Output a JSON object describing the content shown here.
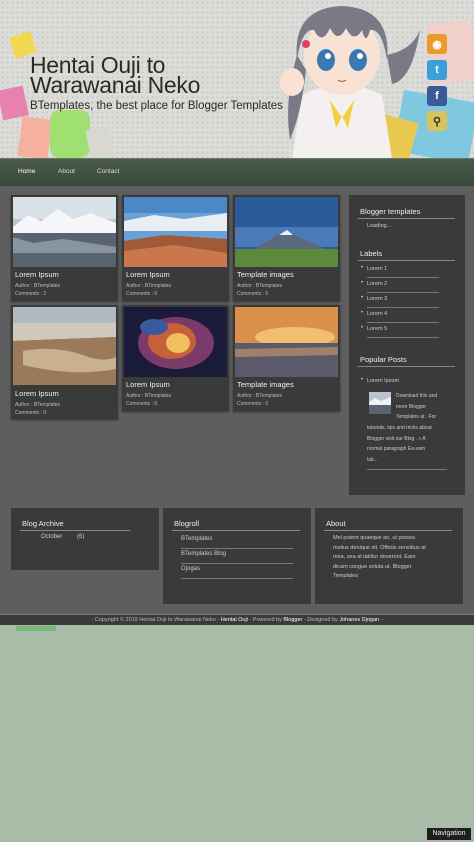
{
  "header": {
    "title": "Hentai Ouji to Warawanai Neko",
    "description": "BTemplates, the best place for Blogger Templates",
    "social": [
      "rss-icon",
      "twitter-icon",
      "facebook-icon",
      "search-icon"
    ],
    "colors": {
      "rss": "#e89a2a",
      "twitter": "#3aa0d8",
      "facebook": "#3b5a9a",
      "search": "#d8c45a"
    }
  },
  "nav": {
    "items": [
      "Home",
      "About",
      "Contact"
    ]
  },
  "posts": [
    {
      "title": "Lorem Ipsum",
      "author": "Author : BTemplates",
      "comments": "Comments : 2"
    },
    {
      "title": "Lorem Ipsum",
      "author": "Author : BTemplates",
      "comments": "Comments : 0"
    },
    {
      "title": "Template images",
      "author": "Author : BTemplates",
      "comments": "Comments : 5"
    },
    {
      "title": "Lorem Ipsum",
      "author": "Author : BTemplates",
      "comments": "Comments : 0"
    },
    {
      "title": "Lorem Ipsum",
      "author": "Author : BTemplates",
      "comments": "Comments : 0"
    },
    {
      "title": "Template images",
      "author": "Author : BTemplates",
      "comments": "Comments : 0"
    }
  ],
  "sidebar": {
    "blogger_heading": "Blogger templates",
    "loading": "Loading...",
    "labels_heading": "Labels",
    "labels": [
      "Lorem 1",
      "Lorem 2",
      "Lorem 3",
      "Lorem 4",
      "Lorem 5"
    ],
    "popular_heading": "Popular Posts",
    "popular_title": "Lorem Ipsum",
    "popular_snippet": [
      "Download this and",
      "more Blogger",
      "Templates at . For",
      "tutorials, tips and tricks about",
      "Blogger visit our Blog . » A",
      "normal paragraph Ea eam",
      "lab..."
    ]
  },
  "footer_widgets": {
    "archive_heading": "Blog Archive",
    "archive_item": "October",
    "archive_count": "(6)",
    "blogroll_heading": "Blogroll",
    "blogroll": [
      "BTemplates",
      "BTemplates Blog",
      "Ojogas"
    ],
    "about_heading": "About",
    "about_text": [
      "Mel putent quaeque an, ut postea",
      "melius denique sit. Officiis sensibus at",
      "mea, sea at labitur deserunt. Eam",
      "dicam congue soluta ut. Blogger",
      "Templates"
    ]
  },
  "footer": {
    "pre": "- Copyright © 2019 Hentai Ouji to Warawanai Neko -",
    "site": "Hentai Ouji",
    "mid1": "- Powered by",
    "blogger": "Blogger",
    "mid2": "- Designed by",
    "designer": "Johanes Djogan",
    "post": "-"
  },
  "navigation_button": "Navigation"
}
